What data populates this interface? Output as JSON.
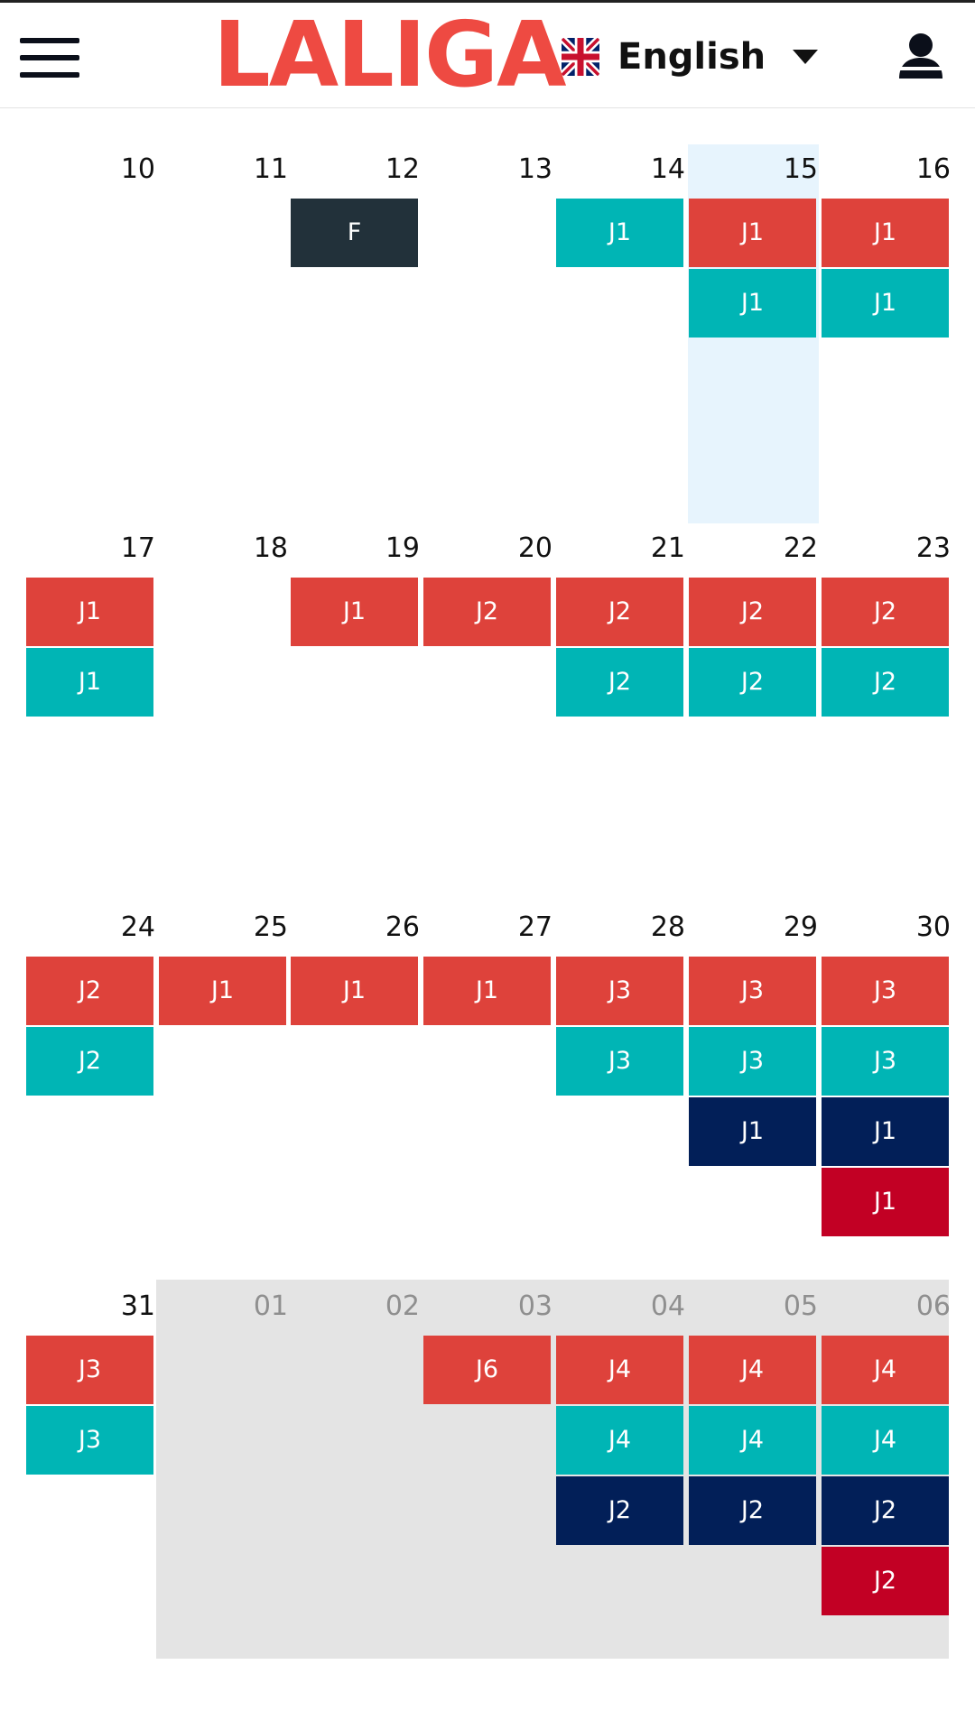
{
  "header": {
    "logo_text": "LALIGA",
    "language": {
      "label": "English",
      "flag_icon": "uk-flag-icon"
    },
    "menu_icon": "hamburger-menu-icon",
    "user_icon": "user-account-icon"
  },
  "colors": {
    "brand_red": "#ee4a42",
    "red": "#de423b",
    "teal": "#00b5b5",
    "navy": "#021f58",
    "crimson": "#c20024",
    "dark": "#22313a",
    "highlight": "#e7f4fd",
    "outside_month": "#e4e4e4"
  },
  "calendar": {
    "today": "15",
    "weeks": [
      {
        "days": [
          {
            "day": "10",
            "events": []
          },
          {
            "day": "11",
            "events": []
          },
          {
            "day": "12",
            "events": [
              {
                "label": "F",
                "color": "dark"
              }
            ]
          },
          {
            "day": "13",
            "events": []
          },
          {
            "day": "14",
            "events": [
              {
                "label": "J1",
                "color": "teal",
                "row": 0
              }
            ]
          },
          {
            "day": "15",
            "events": [
              {
                "label": "J1",
                "color": "red"
              },
              {
                "label": "J1",
                "color": "teal"
              }
            ]
          },
          {
            "day": "16",
            "events": [
              {
                "label": "J1",
                "color": "red"
              },
              {
                "label": "J1",
                "color": "teal"
              }
            ]
          }
        ]
      },
      {
        "days": [
          {
            "day": "17",
            "events": [
              {
                "label": "J1",
                "color": "red"
              },
              {
                "label": "J1",
                "color": "teal"
              }
            ]
          },
          {
            "day": "18",
            "events": []
          },
          {
            "day": "19",
            "events": [
              {
                "label": "J1",
                "color": "red"
              }
            ]
          },
          {
            "day": "20",
            "events": [
              {
                "label": "J2",
                "color": "red"
              }
            ]
          },
          {
            "day": "21",
            "events": [
              {
                "label": "J2",
                "color": "red"
              },
              {
                "label": "J2",
                "color": "teal"
              }
            ]
          },
          {
            "day": "22",
            "events": [
              {
                "label": "J2",
                "color": "red"
              },
              {
                "label": "J2",
                "color": "teal"
              }
            ]
          },
          {
            "day": "23",
            "events": [
              {
                "label": "J2",
                "color": "red"
              },
              {
                "label": "J2",
                "color": "teal"
              }
            ]
          }
        ]
      },
      {
        "days": [
          {
            "day": "24",
            "events": [
              {
                "label": "J2",
                "color": "red"
              },
              {
                "label": "J2",
                "color": "teal"
              }
            ]
          },
          {
            "day": "25",
            "events": [
              {
                "label": "J1",
                "color": "red"
              }
            ]
          },
          {
            "day": "26",
            "events": [
              {
                "label": "J1",
                "color": "red"
              }
            ]
          },
          {
            "day": "27",
            "events": [
              {
                "label": "J1",
                "color": "red"
              }
            ]
          },
          {
            "day": "28",
            "events": [
              {
                "label": "J3",
                "color": "red"
              },
              {
                "label": "J3",
                "color": "teal"
              }
            ]
          },
          {
            "day": "29",
            "events": [
              {
                "label": "J3",
                "color": "red"
              },
              {
                "label": "J3",
                "color": "teal"
              },
              {
                "label": "J1",
                "color": "navy"
              }
            ]
          },
          {
            "day": "30",
            "events": [
              {
                "label": "J3",
                "color": "red"
              },
              {
                "label": "J3",
                "color": "teal"
              },
              {
                "label": "J1",
                "color": "navy"
              },
              {
                "label": "J1",
                "color": "crimson"
              }
            ]
          }
        ]
      },
      {
        "days": [
          {
            "day": "31",
            "events": [
              {
                "label": "J3",
                "color": "red"
              },
              {
                "label": "J3",
                "color": "teal"
              }
            ]
          },
          {
            "day": "01",
            "muted": true,
            "events": []
          },
          {
            "day": "02",
            "muted": true,
            "events": []
          },
          {
            "day": "03",
            "muted": true,
            "events": [
              {
                "label": "J6",
                "color": "red"
              }
            ]
          },
          {
            "day": "04",
            "muted": true,
            "events": [
              {
                "label": "J4",
                "color": "red"
              },
              {
                "label": "J4",
                "color": "teal"
              },
              {
                "label": "J2",
                "color": "navy"
              }
            ]
          },
          {
            "day": "05",
            "muted": true,
            "events": [
              {
                "label": "J4",
                "color": "red"
              },
              {
                "label": "J4",
                "color": "teal"
              },
              {
                "label": "J2",
                "color": "navy"
              }
            ]
          },
          {
            "day": "06",
            "muted": true,
            "events": [
              {
                "label": "J4",
                "color": "red"
              },
              {
                "label": "J4",
                "color": "teal"
              },
              {
                "label": "J2",
                "color": "navy"
              },
              {
                "label": "J2",
                "color": "crimson"
              }
            ]
          }
        ]
      }
    ]
  }
}
